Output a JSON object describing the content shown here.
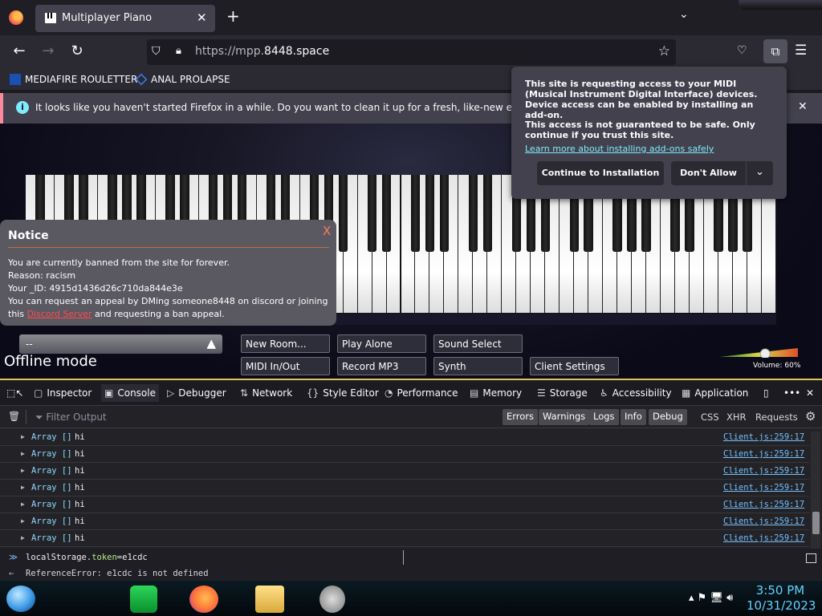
{
  "browser": {
    "tab_title": "Multiplayer Piano",
    "tab_close": "✕",
    "new_tab": "+",
    "url_prefix": "https://mpp.",
    "url_domain": "8448.space",
    "back": "←",
    "forward": "→",
    "reload": "↻"
  },
  "bookmarks": [
    {
      "label": "MEDIAFIRE ROULETTER",
      "icon": "mediafire-icon"
    },
    {
      "label": "ANAL PROLAPSE",
      "icon": "bookmark-icon"
    }
  ],
  "notification": {
    "text": "It looks like you haven't started Firefox in a while. Do you want to clean it up for a fresh, like-new experience? And",
    "close": "✕"
  },
  "midi_popup": {
    "para1": "This site is requesting access to your MIDI (Musical Instrument Digital Interface) devices. Device access can be enabled by installing an add-on.",
    "para2": "This access is not guaranteed to be safe. Only continue if you trust this site.",
    "link": "Learn more about installing add-ons safely",
    "continue_label": "Continue to Installation",
    "deny_label": "Don't Allow"
  },
  "notice": {
    "title": "Notice",
    "close": "X",
    "line1": "You are currently banned from the site for forever.",
    "line2": "Reason: racism",
    "line3": "Your _ID: 4915d1436d26c710da844e3e",
    "line4": "You can request an appeal by DMing someone8448 on discord or joining",
    "line5_pre": "this",
    "line5_link": "Discord Server",
    "line5_post": "and requesting a ban appeal."
  },
  "controls": {
    "room_value": "--",
    "offline": "Offline mode",
    "new_room": "New Room...",
    "play_alone": "Play Alone",
    "sound_select": "Sound Select",
    "midi_inout": "MIDI In/Out",
    "record_mp3": "Record MP3",
    "synth": "Synth",
    "client_settings": "Client Settings",
    "volume_label": "Volume: 60%",
    "volume_level": 0.6
  },
  "devtools": {
    "tabs": [
      "Inspector",
      "Console",
      "Debugger",
      "Network",
      "Style Editor",
      "Performance",
      "Memory",
      "Storage",
      "Accessibility",
      "Application"
    ],
    "active_tab": "Console",
    "filter_placeholder": "Filter Output",
    "filters": [
      "Errors",
      "Warnings",
      "Logs",
      "Info",
      "Debug"
    ],
    "extra_filters": [
      "CSS",
      "XHR",
      "Requests"
    ],
    "log_rows": [
      {
        "type": "Array []",
        "msg": "hi",
        "source": "Client.js:259:17"
      },
      {
        "type": "Array []",
        "msg": "hi",
        "source": "Client.js:259:17"
      },
      {
        "type": "Array []",
        "msg": "hi",
        "source": "Client.js:259:17"
      },
      {
        "type": "Array []",
        "msg": "hi",
        "source": "Client.js:259:17"
      },
      {
        "type": "Array []",
        "msg": "hi",
        "source": "Client.js:259:17"
      },
      {
        "type": "Array []",
        "msg": "hi",
        "source": "Client.js:259:17"
      },
      {
        "type": "Array []",
        "msg": "hi",
        "source": "Client.js:259:17"
      }
    ],
    "command_prefix": "localStorage.",
    "command_token": "token",
    "command_suffix": "=e1cdc",
    "error": "ReferenceError: e1cdc is not defined"
  },
  "taskbar": {
    "time": "3:50 PM",
    "date": "10/31/2023"
  },
  "colors": {
    "accent_devtools": "#e0c35a",
    "link": "#80ebff",
    "notice_close": "#ff7a5a"
  }
}
